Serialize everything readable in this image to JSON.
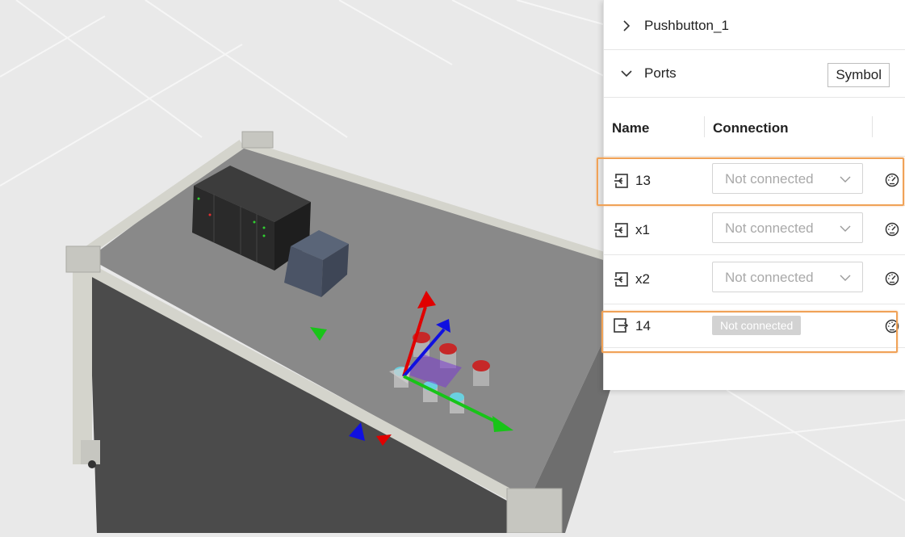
{
  "panel": {
    "component_title": "Pushbutton_1",
    "ports_label": "Ports",
    "symbol_button": "Symbol",
    "columns": {
      "name": "Name",
      "connection": "Connection"
    },
    "ports": [
      {
        "name": "13",
        "direction": "input",
        "connection": "Not connected",
        "style": "dropdown",
        "highlighted": true
      },
      {
        "name": "x1",
        "direction": "input",
        "connection": "Not connected",
        "style": "dropdown",
        "highlighted": false
      },
      {
        "name": "x2",
        "direction": "input",
        "connection": "Not connected",
        "style": "dropdown",
        "highlighted": false
      },
      {
        "name": "14",
        "direction": "output",
        "connection": "Not connected",
        "style": "badge",
        "highlighted": true
      }
    ],
    "icons": [
      "chevron-right-icon",
      "chevron-down-icon",
      "port-input-icon",
      "port-output-icon",
      "gauge-icon"
    ]
  },
  "colors": {
    "highlight": "#f0a257",
    "gizmo_x": "#18c418",
    "gizmo_y": "#e00000",
    "gizmo_z": "#1010e0"
  }
}
